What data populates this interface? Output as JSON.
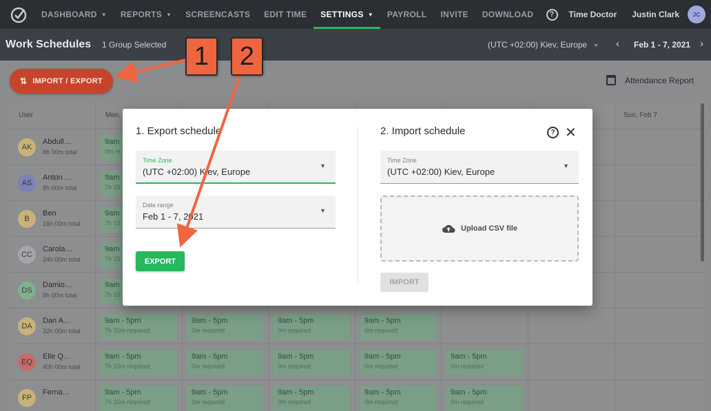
{
  "nav": {
    "items": [
      {
        "label": "DASHBOARD",
        "dropdown": true
      },
      {
        "label": "REPORTS",
        "dropdown": true
      },
      {
        "label": "SCREENCASTS",
        "dropdown": false
      },
      {
        "label": "EDIT TIME",
        "dropdown": false
      },
      {
        "label": "SETTINGS",
        "dropdown": true,
        "active": true
      },
      {
        "label": "PAYROLL",
        "dropdown": false
      },
      {
        "label": "INVITE",
        "dropdown": false
      },
      {
        "label": "DOWNLOAD",
        "dropdown": false
      }
    ],
    "help_icon": "?",
    "company": "Time Doctor",
    "user_name": "Justin Clark",
    "user_initials": "JC"
  },
  "subheader": {
    "title": "Work Schedules",
    "group_selected": "1 Group Selected",
    "timezone": "(UTC +02:00) Kiev, Europe",
    "date_range": "Feb 1 - 7, 2021"
  },
  "toolbar": {
    "import_export_label": "IMPORT / EXPORT",
    "attendance_label": "Attendance Report"
  },
  "grid": {
    "headers": {
      "user": "User",
      "col1": "Mon,",
      "col7": "Sun, Feb 7"
    },
    "rows": [
      {
        "initials": "AK",
        "name": "Abdull…",
        "total": "8h 00m total",
        "color": "#c9b27a",
        "shifts": [
          {
            "time": "9am",
            "req": "0m re"
          }
        ]
      },
      {
        "initials": "AS",
        "name": "Anton …",
        "total": "8h 00m total",
        "color": "#7c82b6",
        "shifts": [
          {
            "time": "9am",
            "req": "7h 15"
          }
        ]
      },
      {
        "initials": "B",
        "name": "Ben",
        "total": "16h 00m total",
        "color": "#c9b27a",
        "shifts": [
          {
            "time": "9am",
            "req": "7h 15"
          }
        ]
      },
      {
        "initials": "CC",
        "name": "Carola…",
        "total": "24h 00m total",
        "color": "#a3a5a8",
        "shifts": [
          {
            "time": "9am",
            "req": "7h 15"
          }
        ]
      },
      {
        "initials": "DS",
        "name": "Damio…",
        "total": "8h 00m total",
        "color": "#7fb08f",
        "shifts": [
          {
            "time": "9am",
            "req": "7h 15"
          }
        ]
      },
      {
        "initials": "DA",
        "name": "Dan A…",
        "total": "32h 00m total",
        "color": "#c9b27a",
        "shifts": [
          {
            "time": "9am - 5pm",
            "req": "7h 15m required"
          },
          {
            "time": "9am - 5pm",
            "req": "0m required"
          },
          {
            "time": "9am - 5pm",
            "req": "0m required"
          },
          {
            "time": "9am - 5pm",
            "req": "0m required"
          }
        ]
      },
      {
        "initials": "EQ",
        "name": "Elle Q…",
        "total": "40h 00m total",
        "color": "#c66a6a",
        "shifts": [
          {
            "time": "9am - 5pm",
            "req": "7h 15m required"
          },
          {
            "time": "9am - 5pm",
            "req": "0m required"
          },
          {
            "time": "9am - 5pm",
            "req": "0m required"
          },
          {
            "time": "9am - 5pm",
            "req": "0m required"
          },
          {
            "time": "9am - 5pm",
            "req": "0m required"
          }
        ]
      },
      {
        "initials": "FP",
        "name": "Ferna…",
        "total": "",
        "color": "#c9b27a",
        "shifts": [
          {
            "time": "9am - 5pm",
            "req": "7h 15m required"
          },
          {
            "time": "9am - 5pm",
            "req": "0m required"
          },
          {
            "time": "9am - 5pm",
            "req": "0m required"
          },
          {
            "time": "9am - 5pm",
            "req": "0m required"
          },
          {
            "time": "9am - 5pm",
            "req": "0m required"
          }
        ]
      }
    ]
  },
  "modal": {
    "export_title": "1. Export schedule",
    "import_title": "2. Import schedule",
    "export_timezone_label": "Time Zone",
    "export_timezone_value": "(UTC +02:00) Kiev, Europe",
    "date_range_label": "Date range",
    "date_range_value": "Feb 1 - 7, 2021",
    "export_button": "EXPORT",
    "import_timezone_label": "Time Zone",
    "import_timezone_value": "(UTC +02:00) Kiev, Europe",
    "upload_label": "Upload CSV file",
    "import_button": "IMPORT",
    "help_icon": "?",
    "close_icon": "✕"
  },
  "callouts": {
    "one": "1",
    "two": "2"
  },
  "colors": {
    "accent": "#27b85e",
    "callout": "#f0653f",
    "import_export": "#c6442a"
  }
}
